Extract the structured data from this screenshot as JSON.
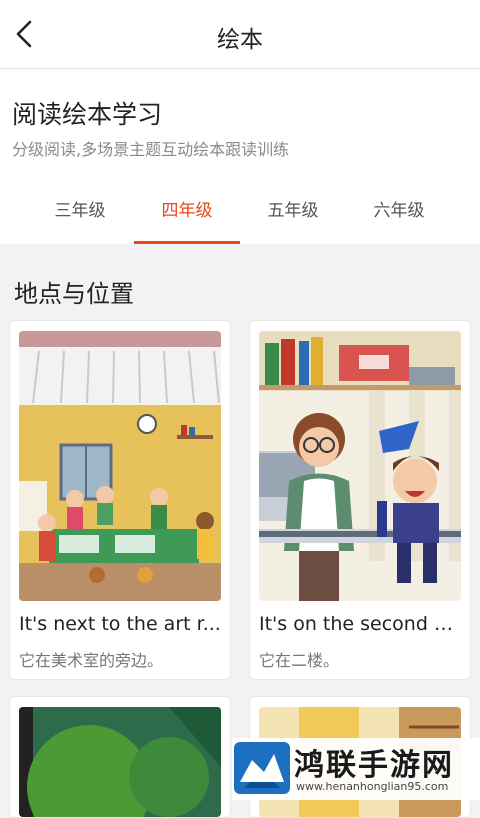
{
  "header": {
    "title": "绘本"
  },
  "intro": {
    "heading": "阅读绘本学习",
    "subtitle": "分级阅读,多场景主题互动绘本跟读训练"
  },
  "tabs": [
    {
      "label": "三年级",
      "active": false
    },
    {
      "label": "四年级",
      "active": true
    },
    {
      "label": "五年级",
      "active": false
    },
    {
      "label": "六年级",
      "active": false
    }
  ],
  "section": {
    "title": "地点与位置"
  },
  "cards": [
    {
      "title": "It's next to the art r...",
      "subtitle": "它在美术室的旁边。"
    },
    {
      "title": "It's on the second fl...",
      "subtitle": "它在二楼。"
    }
  ],
  "watermark": {
    "brand": "鸿联手游网",
    "url": "www.henanhonglian95.com"
  },
  "colors": {
    "accent": "#e8471b",
    "background": "#f2f2f2"
  }
}
